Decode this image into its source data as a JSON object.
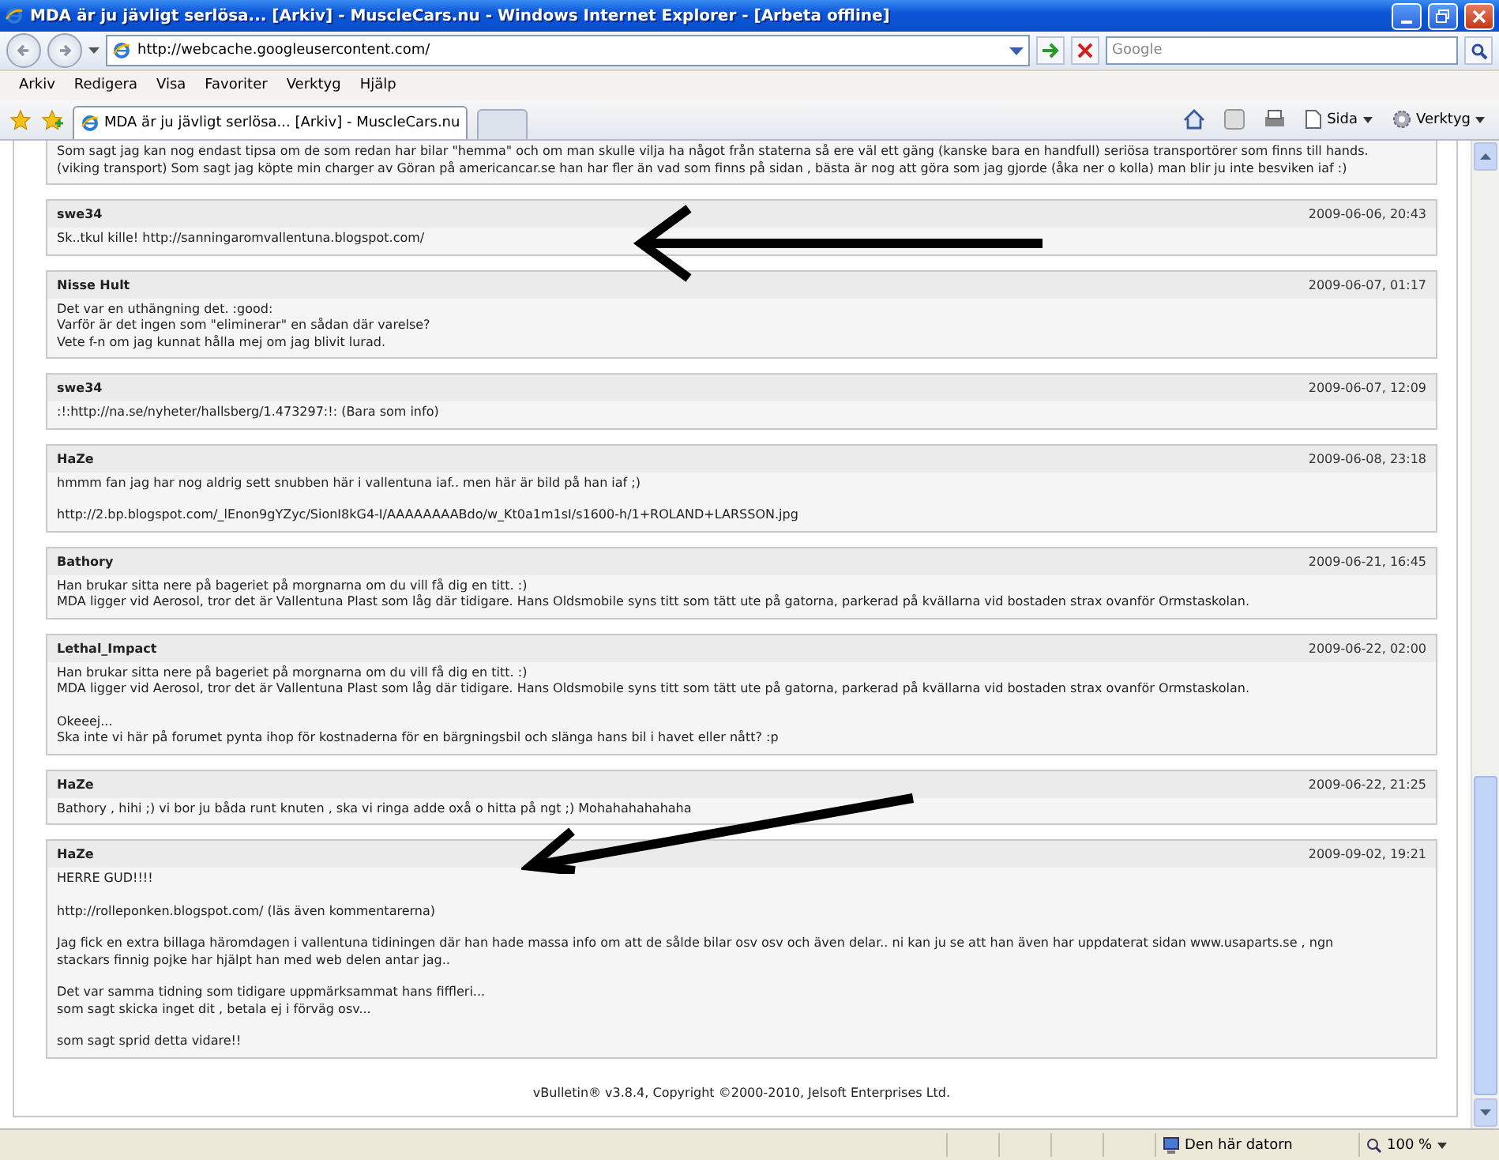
{
  "window": {
    "title": "MDA är ju jävligt serlösa... [Arkiv] - MuscleCars.nu - Windows Internet Explorer - [Arbeta offline]"
  },
  "address_bar": {
    "url": "http://webcache.googleusercontent.com/",
    "search_placeholder": "Google"
  },
  "menu": [
    "Arkiv",
    "Redigera",
    "Visa",
    "Favoriter",
    "Verktyg",
    "Hjälp"
  ],
  "tabs": [
    {
      "label": "MDA är ju jävligt serlösa... [Arkiv] - MuscleCars.nu",
      "selected": true
    }
  ],
  "command_bar": [
    "Sida",
    "Verktyg"
  ],
  "posts": [
    {
      "paragraphs": [
        [
          "Som sagt jag kan nog endast tipsa om de som redan har bilar \"hemma\" och om man skulle vilja ha något från staterna så ere väl ett gäng (kanske bara en handfull) seriösa transportörer som finns till hands.",
          "(viking transport) Som sagt jag köpte min charger av Göran på americancar.se han har fler än vad som finns på sidan , bästa är nog att göra som jag gjorde (åka ner o kolla) man blir ju inte besviken iaf :)"
        ]
      ]
    },
    {
      "author": "swe34",
      "date": "2009-06-06, 20:43",
      "paragraphs": [
        [
          "Sk..tkul kille! http://sanningaromvallentuna.blogspot.com/"
        ]
      ]
    },
    {
      "author": "Nisse Hult",
      "date": "2009-06-07, 01:17",
      "paragraphs": [
        [
          "Det var en uthängning det. :good:",
          "Varför är det ingen som \"eliminerar\" en sådan där varelse?",
          "Vete f-n om jag kunnat hålla mej om jag blivit lurad."
        ]
      ]
    },
    {
      "author": "swe34",
      "date": "2009-06-07, 12:09",
      "paragraphs": [
        [
          ":!:http://na.se/nyheter/hallsberg/1.473297:!: (Bara som info)"
        ]
      ]
    },
    {
      "author": "HaZe",
      "date": "2009-06-08, 23:18",
      "paragraphs": [
        [
          "hmmm fan jag har nog aldrig sett snubben här i vallentuna iaf.. men här är bild på han iaf ;)"
        ],
        [
          "http://2.bp.blogspot.com/_lEnon9gYZyc/SionI8kG4-I/AAAAAAAABdo/w_Kt0a1m1sI/s1600-h/1+ROLAND+LARSSON.jpg"
        ]
      ]
    },
    {
      "author": "Bathory",
      "date": "2009-06-21, 16:45",
      "paragraphs": [
        [
          "Han brukar sitta nere på bageriet på morgnarna om du vill få dig en titt. :)",
          "MDA ligger vid Aerosol, tror det är Vallentuna Plast som låg där tidigare. Hans Oldsmobile syns titt som tätt ute på gatorna, parkerad på kvällarna vid bostaden strax ovanför Ormstaskolan."
        ]
      ]
    },
    {
      "author": "Lethal_Impact",
      "date": "2009-06-22, 02:00",
      "paragraphs": [
        [
          "Han brukar sitta nere på bageriet på morgnarna om du vill få dig en titt. :)",
          "MDA ligger vid Aerosol, tror det är Vallentuna Plast som låg där tidigare. Hans Oldsmobile syns titt som tätt ute på gatorna, parkerad på kvällarna vid bostaden strax ovanför Ormstaskolan."
        ],
        [
          "Okeeej...",
          "Ska inte vi här på forumet pynta ihop för kostnaderna för en bärgningsbil och slänga hans bil i havet eller nått? :p"
        ]
      ]
    },
    {
      "author": "HaZe",
      "date": "2009-06-22, 21:25",
      "paragraphs": [
        [
          "Bathory , hihi ;) vi bor ju båda runt knuten , ska vi ringa adde oxå o hitta på ngt ;) Mohahahahahaha"
        ]
      ]
    },
    {
      "author": "HaZe",
      "date": "2009-09-02, 19:21",
      "paragraphs": [
        [
          "HERRE GUD!!!!"
        ],
        [
          "http://rolleponken.blogspot.com/ (läs även kommentarerna)"
        ],
        [
          "Jag fick en extra billaga häromdagen i vallentuna tidiningen där han hade massa info om att de sålde bilar osv osv och även delar.. ni kan ju se att han även har uppdaterat sidan www.usaparts.se , ngn",
          "stackars finnig pojke har hjälpt han med web delen antar jag.."
        ],
        [
          "Det var samma tidning som tidigare uppmärksammat hans fiffleri...",
          "som sagt skicka inget dit , betala ej i förväg osv..."
        ],
        [
          "som sagt sprid detta vidare!!"
        ]
      ]
    }
  ],
  "footer": "vBulletin® v3.8.4, Copyright ©2000-2010, Jelsoft Enterprises Ltd.",
  "status_bar": {
    "zone": "Den här datorn",
    "zoom": "100 %"
  }
}
